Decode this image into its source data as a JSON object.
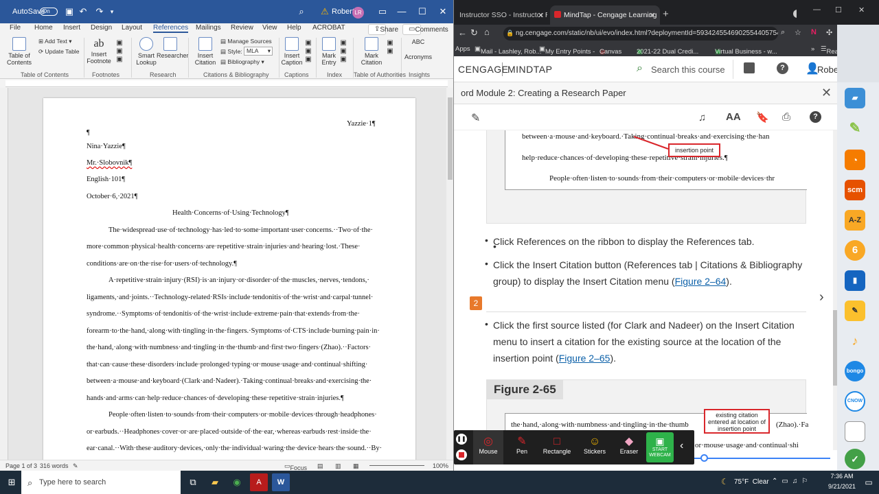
{
  "word": {
    "autosave": "AutoSave",
    "autosave_state": "On",
    "user": "Robert",
    "user_initials": "LR",
    "tabs": [
      "File",
      "Home",
      "Insert",
      "Design",
      "Layout",
      "References",
      "Mailings",
      "Review",
      "View",
      "Help",
      "ACROBAT"
    ],
    "active_tab": "References",
    "share": "Share",
    "comments": "Comments",
    "ribbon": {
      "toc": "Table of Contents",
      "add_text": "Add Text",
      "update_table": "Update Table",
      "insert_footnote": "Insert Footnote",
      "ab_glyph": "ab",
      "smart_lookup": "Smart Lookup",
      "researcher": "Researcher",
      "insert_citation": "Insert Citation",
      "manage_sources": "Manage Sources",
      "style_label": "Style:",
      "style_value": "MLA",
      "bibliography": "Bibliography",
      "insert_caption": "Insert Caption",
      "mark_entry": "Mark Entry",
      "mark_citation": "Mark Citation",
      "abc_glyph": "ABC",
      "acronyms": "Acronyms",
      "groups": [
        "Table of Contents",
        "Footnotes",
        "Research",
        "Citations & Bibliography",
        "Captions",
        "Index",
        "Table of Authorities",
        "Insights"
      ]
    },
    "header_text": "Yazzie·1¶",
    "pilcrow": "¶",
    "lines": [
      "Nina·Yazzie¶",
      "Mr.·Slobovnik¶",
      "English·101¶",
      "October·6,·2021¶",
      "Health·Concerns·of·Using·Technology¶",
      "The·widespread·use·of·technology·has·led·to·some·important·user·concerns.··Two·of·the·",
      "more·common·physical·health·concerns·are·repetitive·strain·injuries·and·hearing·lost.·These·",
      "conditions·are·on·the·rise·for·users·of·technology.¶",
      "A·repetitive·strain·injury·(RSI)·is·an·injury·or·disorder·of·the·muscles,·nerves,·tendons,·",
      "ligaments,·and·joints.··Technology-related·RSIs·include·tendonitis·of·the·wrist·and·carpal·tunnel·",
      "syndrome.··Symptoms·of·tendonitis·of·the·wrist·include·extreme·pain·that·extends·from·the·",
      "forearm·to·the·hand,·along·with·tingling·in·the·fingers.·Symptoms·of·CTS·include·burning·pain·in·",
      "the·hand,·along·with·numbness·and·tingling·in·the·thumb·and·first·two·fingers·(Zhao).··Factors·",
      "that·can·cause·these·disorders·include·prolonged·typing·or·mouse·usage·and·continual·shifting·",
      "between·a·mouse·and·keyboard·(Clark·and·Nadeer).·Taking·continual·breaks·and·exercising·the·",
      "hands·and·arms·can·help·reduce·chances·of·developing·these·repetitive·strain·injuries.¶",
      "People·often·listen·to·sounds·from·their·computers·or·mobile·devices·through·headphones·",
      "or·earbuds.··Headphones·cover·or·are·placed·outside·of·the·ear,·whereas·earbuds·rest·inside·the·",
      "ear·canal.··With·these·auditory·devices,·only·the·individual·waring·the·device·hears·the·sound.··By·"
    ],
    "status": {
      "page": "Page 1 of 3",
      "words": "316 words",
      "focus": "Focus",
      "zoom": "100%"
    }
  },
  "browser": {
    "tabs": [
      {
        "label": "Instructor SSO - Instructor Resou"
      },
      {
        "label": "MindTap - Cengage Learning"
      }
    ],
    "url": "ng.cengage.com/static/nb/ui/evo/index.html?deploymentId=59342455469025544057547...",
    "bookmarks": [
      "Apps",
      "Mail - Lashley, Rob...",
      "My Entry Points -",
      "Canvas",
      "2021-22 Dual Credi...",
      "Virtual Business - w...",
      "Reading list"
    ],
    "brand_left": "CENGAGE",
    "brand_right": "MINDTAP",
    "search_placeholder": "Search this course",
    "user": "Robert",
    "module_title": "ord Module 2: Creating a Research Paper",
    "tool_text_size": "AA",
    "fig_top": {
      "line1": "between·a·mouse·and·keyboard.·Taking·continual·breaks·and·exercising·the·han",
      "line2": "help·reduce·chances·of·developing·these·repetitive·strain·injuries.¶",
      "line3": "People·often·listen·to·sounds·from·their·computers·or·mobile·devices·thr",
      "callout": "insertion point"
    },
    "bullets": [
      "Click References on the ribbon to display the References tab.",
      "Click the Insert Citation button (References tab | Citations & Bibliography group) to display the Insert Citation menu (",
      "Click the first source listed (for Clark and Nadeer) on the Insert Citation menu to insert a citation for the existing source at the location of the insertion point ("
    ],
    "bullet_links": [
      "Figure 2–64",
      "Figure 2–65"
    ],
    "link_close": ").",
    "step_number": "2",
    "fig_title": "Figure 2-65",
    "fig_bottom": {
      "line1": "the·hand,·along·with·numbness·and·tingling·in·the·thumb",
      "line1b": "(Zhao).·Fa",
      "line2": "or·mouse·usage·and·continual·shi",
      "callout": "existing citation entered at location of insertion point"
    }
  },
  "zoom_toolbar": {
    "buttons": [
      "Mouse",
      "Pen",
      "Rectangle",
      "Stickers",
      "Eraser",
      "START WEBCAM"
    ]
  },
  "sidebar": {
    "icons": [
      "briefcase-icon",
      "highlighter-icon",
      "rss-icon",
      "scm-icon",
      "a-z-icon",
      "six-icon",
      "book-icon",
      "notes-icon",
      "audio-icon",
      "bongo-icon",
      "cnow-icon",
      "note-icon",
      "check-icon"
    ],
    "labels": {
      "rss": "",
      "scm": "scm",
      "az": "A-Z",
      "six": "6",
      "bongo": "bongo",
      "cnow": "CNOW"
    }
  },
  "taskbar": {
    "search_placeholder": "Type here to search",
    "weather": "75°F  Clear",
    "time": "7:36 AM",
    "date": "9/21/2021"
  },
  "colors": {
    "word_blue": "#2b579a",
    "cengage_orange": "#e8792b",
    "callout_red": "#d9262b",
    "link": "#0a5fa8"
  }
}
